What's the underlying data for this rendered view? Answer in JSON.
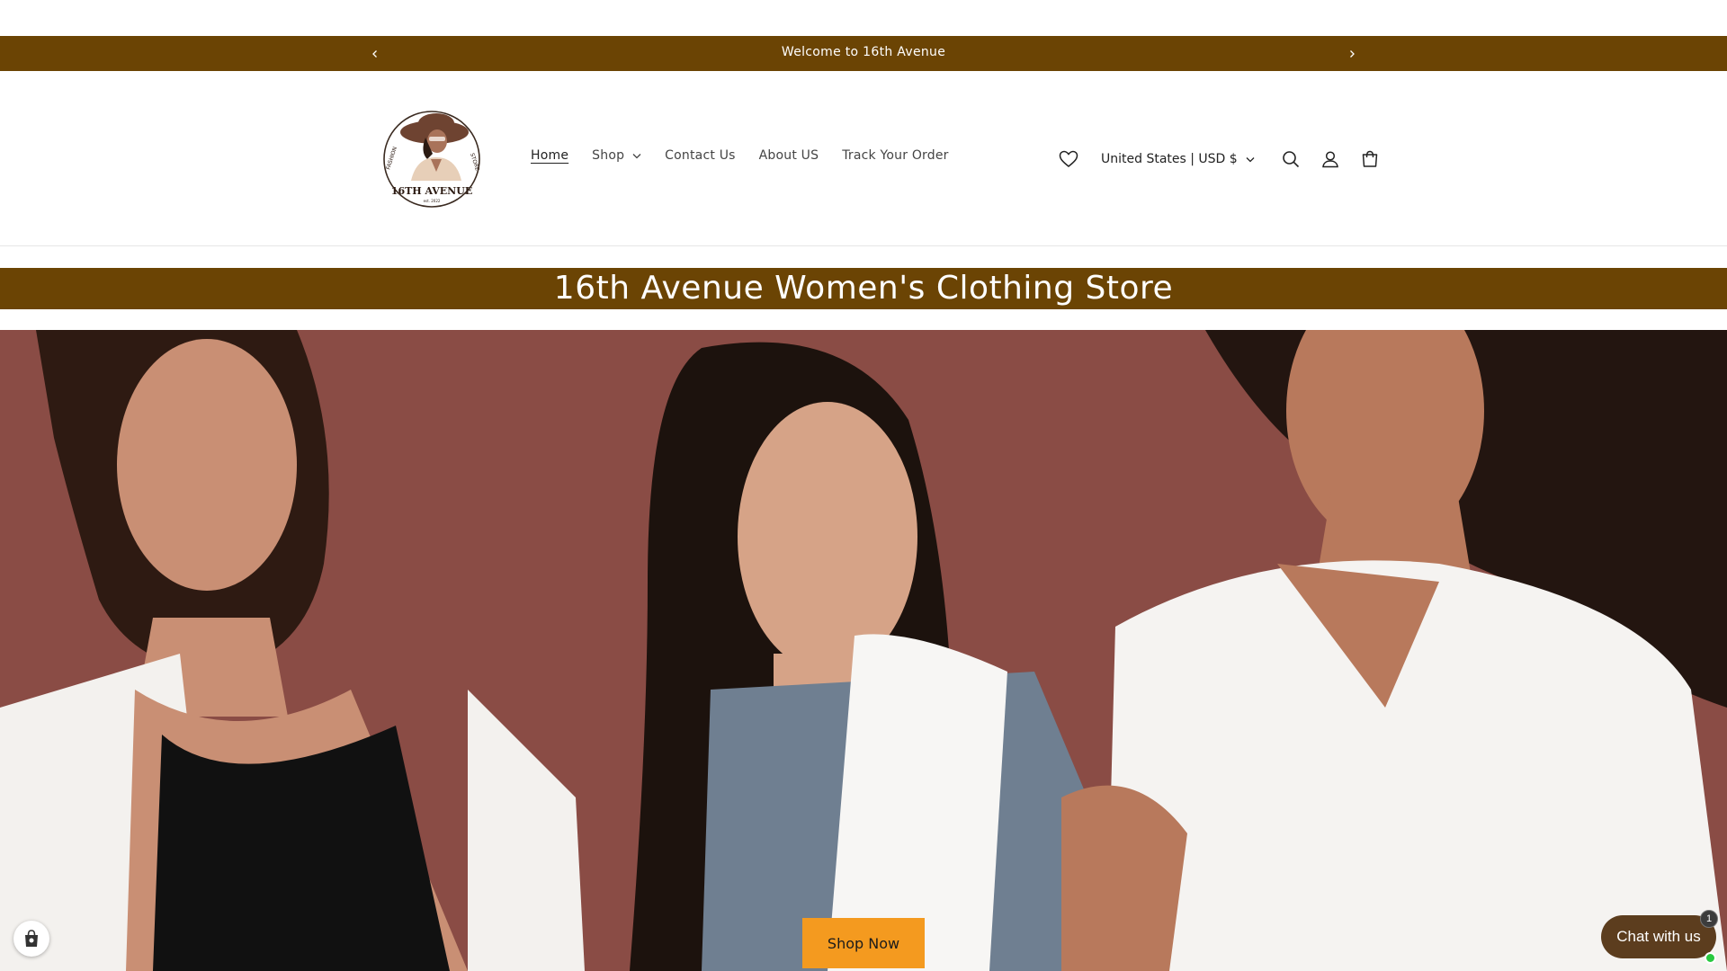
{
  "announcement": {
    "message": "Welcome to 16th Avenue",
    "prev_icon": "chevron-left-icon",
    "next_icon": "chevron-right-icon"
  },
  "logo": {
    "top_text": "FASHION",
    "right_text": "STORE",
    "name": "16TH AVENUE",
    "est": "est. 2022"
  },
  "nav": {
    "items": [
      {
        "label": "Home",
        "active": true
      },
      {
        "label": "Shop",
        "has_dropdown": true
      },
      {
        "label": "Contact Us"
      },
      {
        "label": "About US"
      },
      {
        "label": "Track Your Order"
      }
    ]
  },
  "utilities": {
    "wishlist_icon": "heart-icon",
    "country_selector": "United States | USD $",
    "search_icon": "search-icon",
    "account_icon": "user-icon",
    "cart_icon": "cart-icon"
  },
  "banner": {
    "title": "16th Avenue Women's Clothing Store"
  },
  "hero": {
    "cta_label": "Shop Now"
  },
  "chat": {
    "label": "Chat with us",
    "unread_count": "1"
  },
  "colors": {
    "brand_brown": "#6b4404",
    "cta_orange": "#f49a1f",
    "chat_brown": "#5c3d1e",
    "hero_backdrop": "#8a4c45"
  }
}
